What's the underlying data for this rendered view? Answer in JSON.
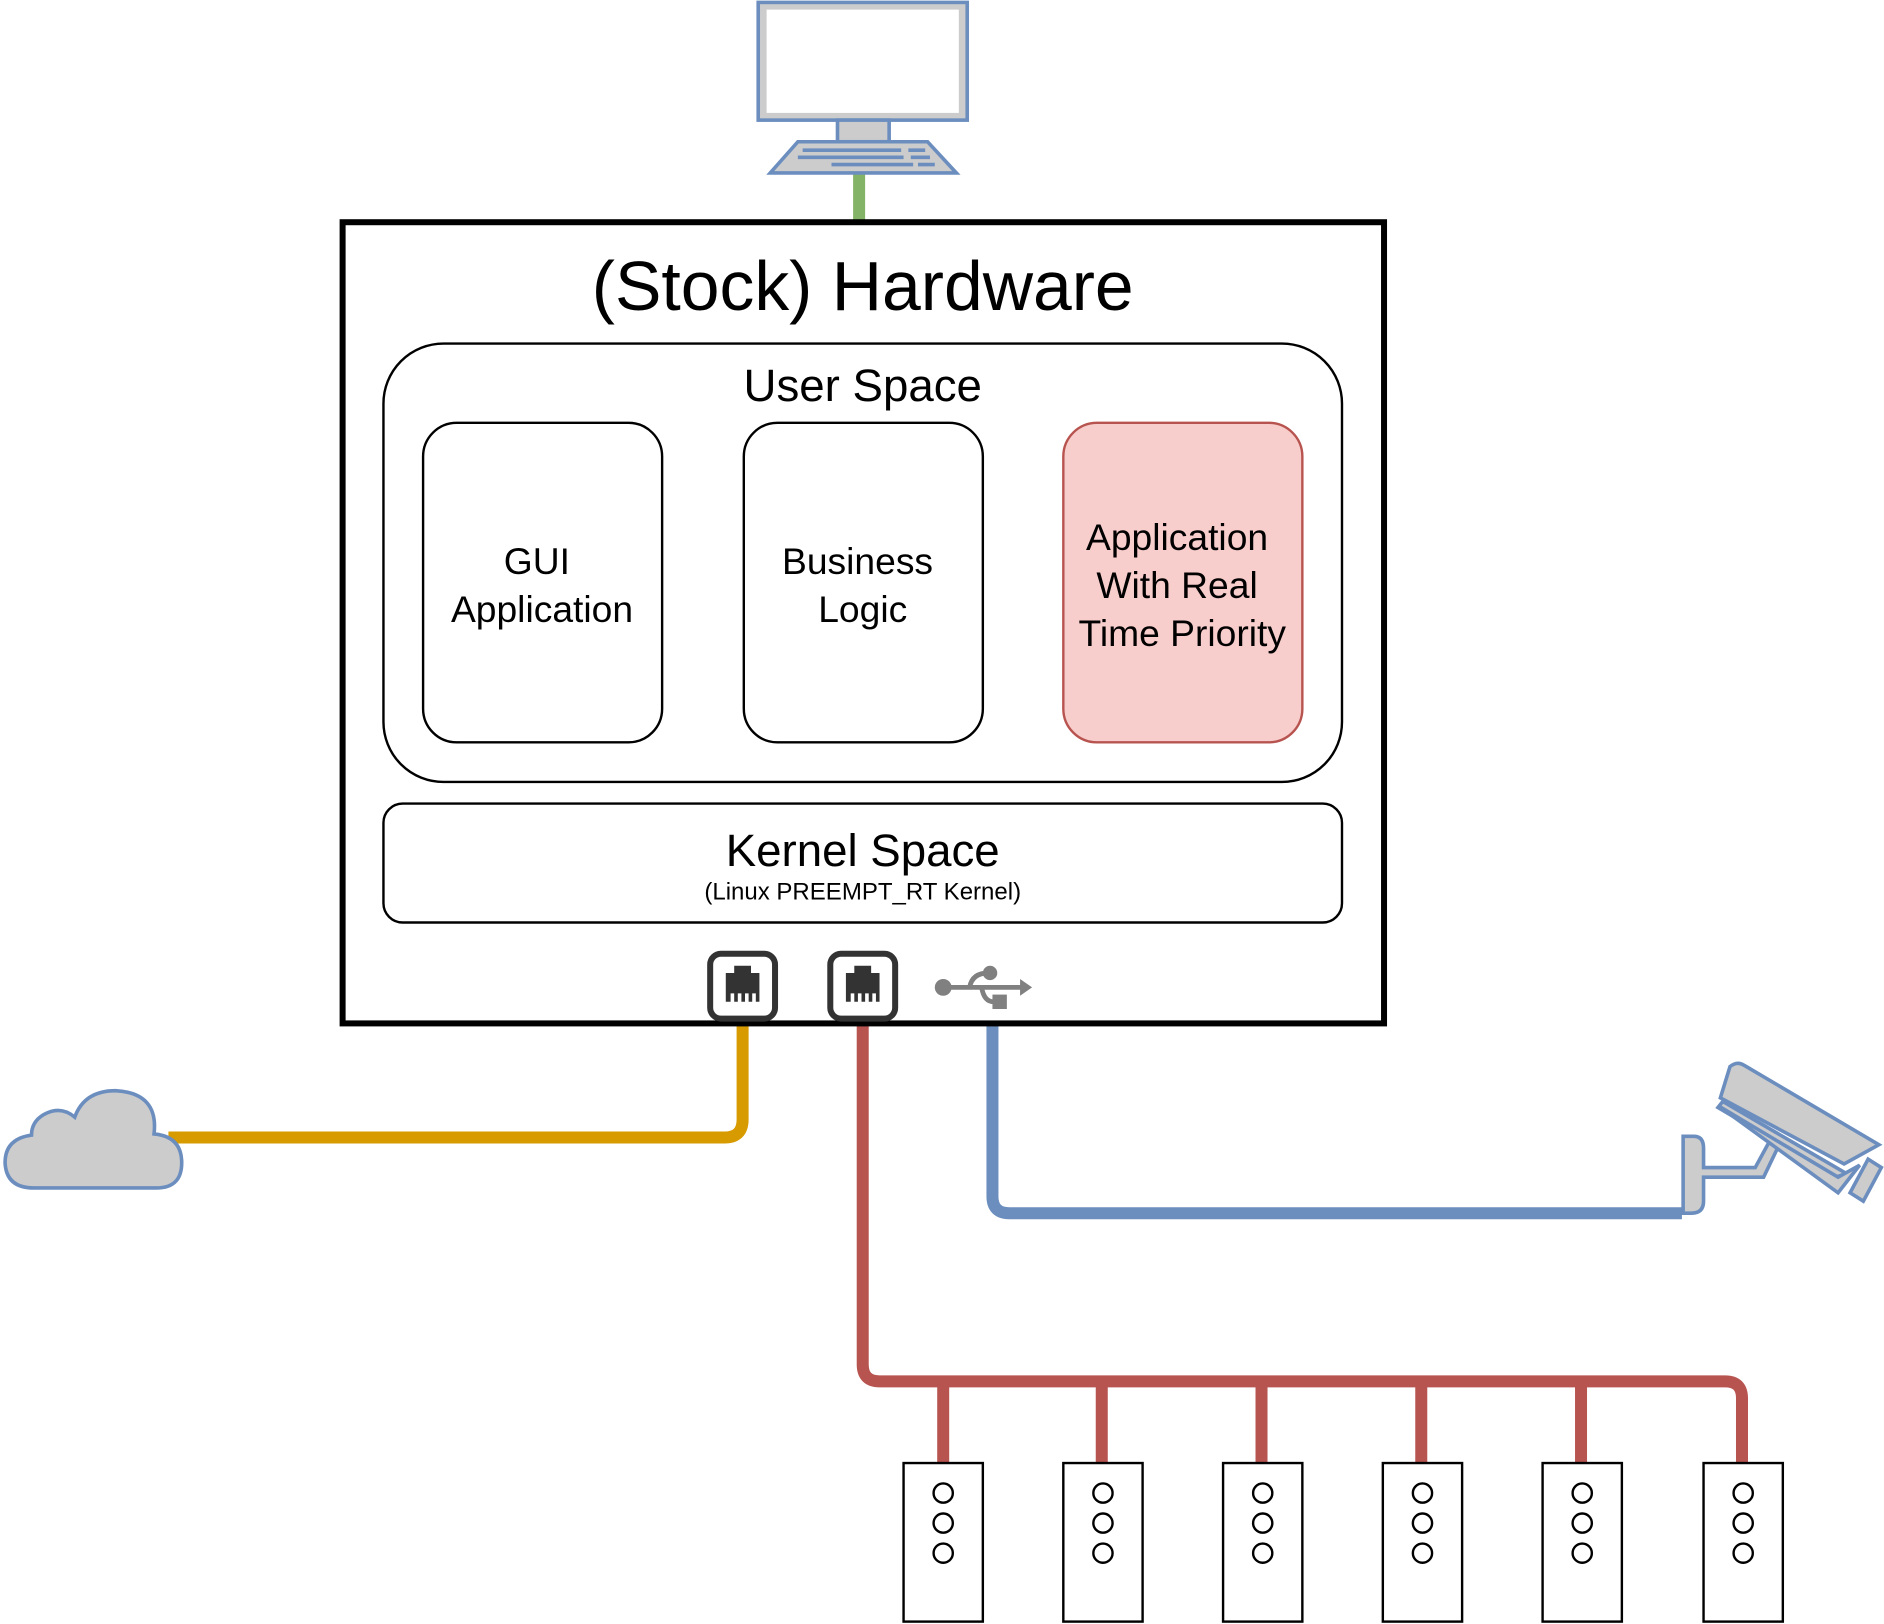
{
  "hardware": {
    "title": "(Stock) Hardware"
  },
  "user_space": {
    "title": "User Space",
    "apps": [
      {
        "lines": [
          "GUI",
          "Application"
        ]
      },
      {
        "lines": [
          "Business",
          "Logic"
        ]
      },
      {
        "lines": [
          "Application",
          "With Real",
          "Time Priority"
        ],
        "highlight": true
      }
    ]
  },
  "kernel_space": {
    "title": "Kernel Space",
    "subtitle": "(Linux PREEMPT_RT Kernel)"
  },
  "ports": [
    "ethernet-port",
    "ethernet-port",
    "usb-port"
  ],
  "colors": {
    "monitor_link": "#82b366",
    "cloud_link": "#d79b00",
    "fieldbus_link": "#b85450",
    "camera_link": "#6c8ebf",
    "realtime_fill": "#f8cecc",
    "realtime_stroke": "#b85450",
    "device_outline": "#6c8ebf",
    "device_fill": "#cccccc"
  },
  "icons": [
    "computer-monitor-icon",
    "cloud-icon",
    "security-camera-icon",
    "ethernet-icon",
    "usb-icon",
    "io-device-icon"
  ],
  "io_device_count": 6
}
